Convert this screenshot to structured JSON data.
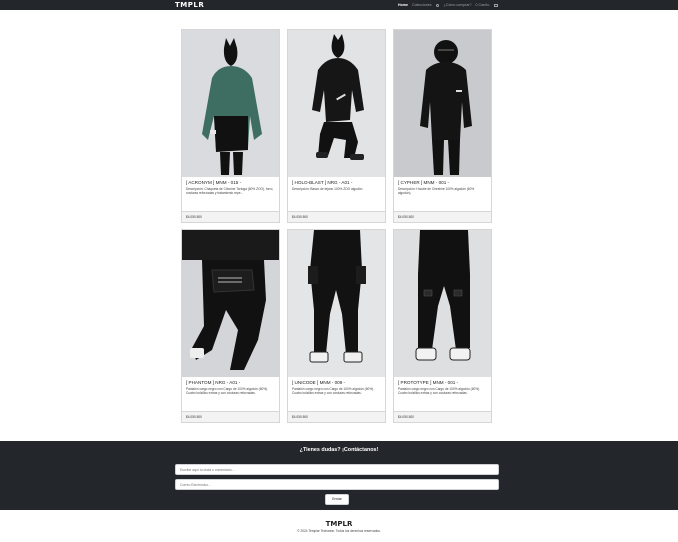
{
  "header": {
    "logo": "TMPLR",
    "nav": [
      {
        "label": "Home",
        "active": true
      },
      {
        "label": "Colecciones",
        "active": false
      },
      {
        "label": "¿Cómo comprar?",
        "active": false
      },
      {
        "label": "0 Carrito",
        "active": false
      }
    ]
  },
  "products": [
    {
      "title": "[ ACRONYM ] MNM - 015 -",
      "desc": "Descripción: Chaqueta de Chlorine Tortuga (60% ZOO), forro, costuras reforzadas y tratamiento repe...",
      "price": "$4.050.500",
      "icon": "person-green-hoodie"
    },
    {
      "title": "[ HOLO-BLAST ] NRG - A01 -",
      "desc": "Descripción: Basco de tejano 100% ZOO algodón",
      "price": "$4.050.500",
      "icon": "person-black-crouch"
    },
    {
      "title": "[ CYPHER ] MNM - 001 -",
      "desc": "Descripción: Hoodie de Cheshire 100% algodón (60% algodón).",
      "price": "$4.050.500",
      "icon": "person-black-helmet"
    },
    {
      "title": "[ PHANTOM ] NRG - A01 -",
      "desc": "Pantalón cargo negro con Cargo de 100% algodón (60%). Cuatro bolsillos extras y con costuras reforzadas.",
      "price": "$4.050.500",
      "icon": "pants-bag"
    },
    {
      "title": "[ UNICODE ] MNM - 009 -",
      "desc": "Pantalón cargo negro con Cargo de 100% algodón (60%). Cuatro bolsillos extras y con costuras reforzadas.",
      "price": "$4.050.500",
      "icon": "pants-straps"
    },
    {
      "title": "[ PROTOTYPE ] MNM - 001 -",
      "desc": "Pantalón cargo negro con Cargo de 100% algodón (60%). Cuatro bolsillos extras y con costuras reforzadas.",
      "price": "$4.050.500",
      "icon": "pants-buckles"
    }
  ],
  "contact": {
    "title": "¿Tienes dudas? ¡Contáctanos!",
    "message_placeholder": "Escribe aquí tu duda o comentario...",
    "email_placeholder": "Correo Electrónico...",
    "send_label": "Enviar"
  },
  "footer": {
    "logo": "TMPLR",
    "copyright": "© 2024 Templar Techwear. Todos los derechos reservados."
  },
  "colors": {
    "dark": "#23262b",
    "green_hoodie": "#3e6e62"
  }
}
